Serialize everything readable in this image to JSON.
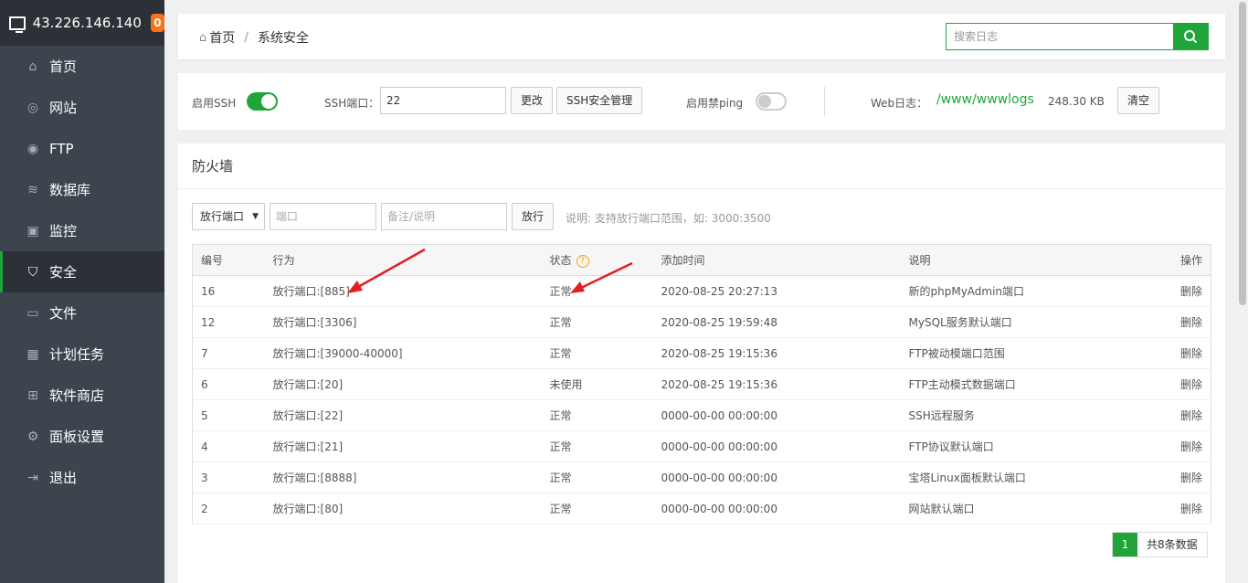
{
  "sidebar": {
    "ip": "43.226.146.140",
    "badge": "0",
    "items": [
      {
        "label": "首页",
        "icon": "home-icon"
      },
      {
        "label": "网站",
        "icon": "globe-icon"
      },
      {
        "label": "FTP",
        "icon": "ftp-icon"
      },
      {
        "label": "数据库",
        "icon": "database-icon"
      },
      {
        "label": "监控",
        "icon": "monitor-icon"
      },
      {
        "label": "安全",
        "icon": "shield-icon",
        "active": true
      },
      {
        "label": "文件",
        "icon": "folder-icon"
      },
      {
        "label": "计划任务",
        "icon": "calendar-icon"
      },
      {
        "label": "软件商店",
        "icon": "apps-icon"
      },
      {
        "label": "面板设置",
        "icon": "gear-icon"
      },
      {
        "label": "退出",
        "icon": "logout-icon"
      }
    ]
  },
  "header": {
    "breadcrumb_home": "首页",
    "breadcrumb_sep": "/",
    "breadcrumb_current": "系统安全",
    "search_placeholder": "搜索日志"
  },
  "ssh": {
    "enable_ssh_label": "启用SSH",
    "ssh_enabled": true,
    "port_label": "SSH端口：",
    "port_value": "22",
    "change_button": "更改",
    "manage_button": "SSH安全管理",
    "ping_label": "启用禁ping",
    "ping_enabled": false,
    "weblog_label": "Web日志：",
    "weblog_path": "/www/wwwlogs",
    "weblog_size": "248.30 KB",
    "clear_button": "清空"
  },
  "firewall": {
    "title": "防火墙",
    "select_value": "放行端口",
    "port_placeholder": "端口",
    "remark_placeholder": "备注/说明",
    "release_button": "放行",
    "hint": "说明: 支持放行端口范围，如: 3000:3500",
    "columns": {
      "id": "编号",
      "action": "行为",
      "status": "状态",
      "time": "添加时间",
      "desc": "说明",
      "op": "操作"
    },
    "rows": [
      {
        "id": "16",
        "action": "放行端口:[885]",
        "status": "正常",
        "time": "2020-08-25 20:27:13",
        "desc": "新的phpMyAdmin端口",
        "op": "删除"
      },
      {
        "id": "12",
        "action": "放行端口:[3306]",
        "status": "正常",
        "time": "2020-08-25 19:59:48",
        "desc": "MySQL服务默认端口",
        "op": "删除"
      },
      {
        "id": "7",
        "action": "放行端口:[39000-40000]",
        "status": "正常",
        "time": "2020-08-25 19:15:36",
        "desc": "FTP被动模端口范围",
        "op": "删除"
      },
      {
        "id": "6",
        "action": "放行端口:[20]",
        "status": "未使用",
        "time": "2020-08-25 19:15:36",
        "desc": "FTP主动模式数据端口",
        "op": "删除"
      },
      {
        "id": "5",
        "action": "放行端口:[22]",
        "status": "正常",
        "time": "0000-00-00 00:00:00",
        "desc": "SSH远程服务",
        "op": "删除"
      },
      {
        "id": "4",
        "action": "放行端口:[21]",
        "status": "正常",
        "time": "0000-00-00 00:00:00",
        "desc": "FTP协议默认端口",
        "op": "删除"
      },
      {
        "id": "3",
        "action": "放行端口:[8888]",
        "status": "正常",
        "time": "0000-00-00 00:00:00",
        "desc": "宝塔Linux面板默认端口",
        "op": "删除"
      },
      {
        "id": "2",
        "action": "放行端口:[80]",
        "status": "正常",
        "time": "0000-00-00 00:00:00",
        "desc": "网站默认端口",
        "op": "删除"
      }
    ],
    "pager_current": "1",
    "pager_total": "共8条数据"
  },
  "colors": {
    "accent": "#20a53a",
    "sidebar_bg": "#3c444d",
    "sidebar_header_bg": "#2c3138",
    "badge": "#f7741b",
    "annotation_arrow": "#e02020"
  }
}
